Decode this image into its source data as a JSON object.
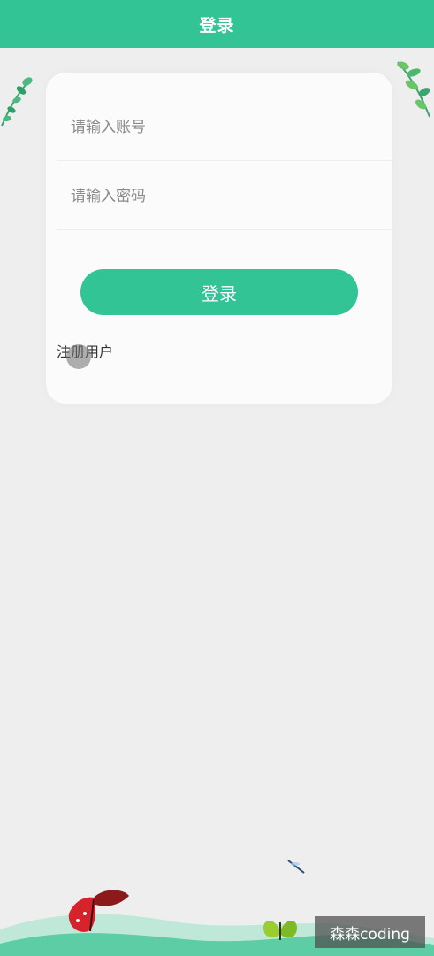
{
  "header": {
    "title": "登录"
  },
  "login_form": {
    "account_placeholder": "请输入账号",
    "password_placeholder": "请输入密码",
    "login_button_label": "登录",
    "register_link_label": "注册用户"
  },
  "watermark": {
    "text": "森森coding"
  },
  "colors": {
    "accent": "#33c496",
    "background": "#efeeef",
    "card": "#fbfbfc"
  },
  "icons": {
    "top_left_decoration": "leaf-branch-icon",
    "top_right_decoration": "leaf-branch-icon",
    "bottom_left_decoration": "red-butterfly-icon",
    "bottom_right_decoration": "green-butterfly-icon",
    "bottom_center_decoration": "dragonfly-icon"
  }
}
